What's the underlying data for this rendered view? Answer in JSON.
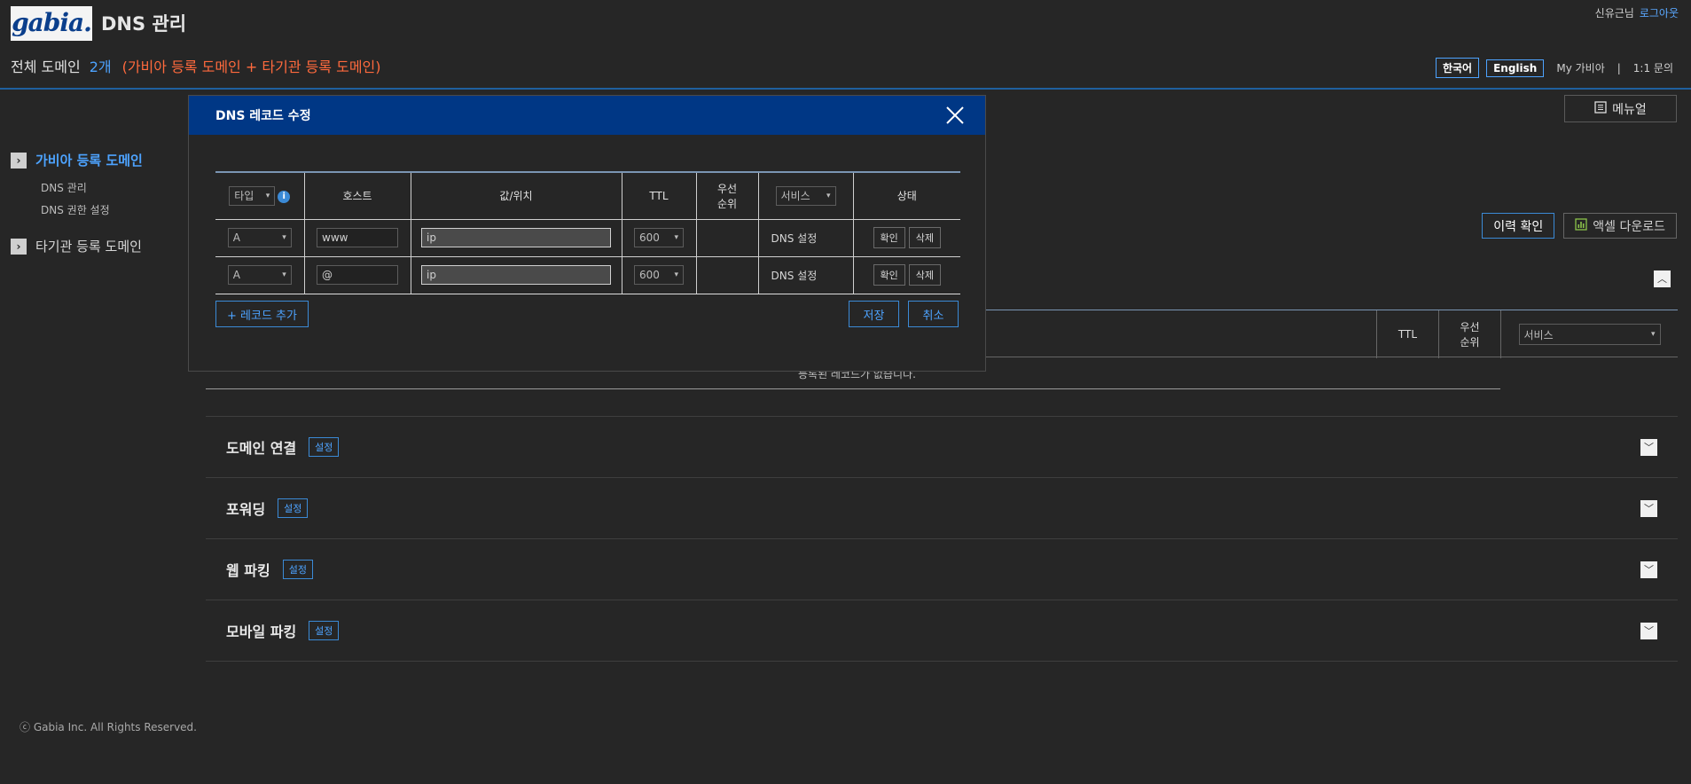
{
  "header": {
    "logo_text": "gabia.",
    "app_title": "DNS 관리",
    "user_name": "신유근님",
    "logout": "로그아웃"
  },
  "domain_summary": {
    "label": "전체 도메인",
    "count": "2개",
    "sub": "(가비아 등록 도메인 + 타기관 등록 도메인)"
  },
  "top_links": {
    "lang_ko": "한국어",
    "lang_en": "English",
    "my_gabia": "My 가비아",
    "separator": "|",
    "inquiry": "1:1 문의"
  },
  "manual_button": "메뉴얼",
  "sidebar": {
    "group1": "가비아 등록 도메인",
    "group1_items": [
      "DNS 관리",
      "DNS 권한 설정"
    ],
    "group2": "타기관 등록 도메인"
  },
  "background": {
    "history_btn": "이력 확인",
    "excel_btn": "액셀 다운로드",
    "col_ttl": "TTL",
    "col_priority": "우선\n순위",
    "service_select": "서비스",
    "empty_text": "등록된 레코드가 없습니다.",
    "sections": [
      {
        "title": "도메인 연결",
        "btn": "설정"
      },
      {
        "title": "포워딩",
        "btn": "설정"
      },
      {
        "title": "웹 파킹",
        "btn": "설정"
      },
      {
        "title": "모바일 파킹",
        "btn": "설정"
      }
    ]
  },
  "modal": {
    "title": "DNS 레코드 수정",
    "headers": {
      "type": "타입",
      "host": "호스트",
      "value": "값/위치",
      "ttl": "TTL",
      "priority_1": "우선",
      "priority_2": "순위",
      "service": "서비스",
      "status": "상태"
    },
    "records": [
      {
        "type": "A",
        "host": "www",
        "value": "ip",
        "ttl": "600",
        "priority": "",
        "service": "DNS 설정",
        "confirm": "확인",
        "delete": "삭제"
      },
      {
        "type": "A",
        "host": "@",
        "value": "ip",
        "ttl": "600",
        "priority": "",
        "service": "DNS 설정",
        "confirm": "확인",
        "delete": "삭제"
      }
    ],
    "add_record": "+ 레코드 추가",
    "save": "저장",
    "cancel": "취소"
  },
  "footer": "ⓒ Gabia Inc. All Rights Reserved.",
  "colors": {
    "background": "#262626",
    "modal_header": "#003785",
    "accent": "#4da3ff",
    "highlight": "#ff6a3d"
  }
}
